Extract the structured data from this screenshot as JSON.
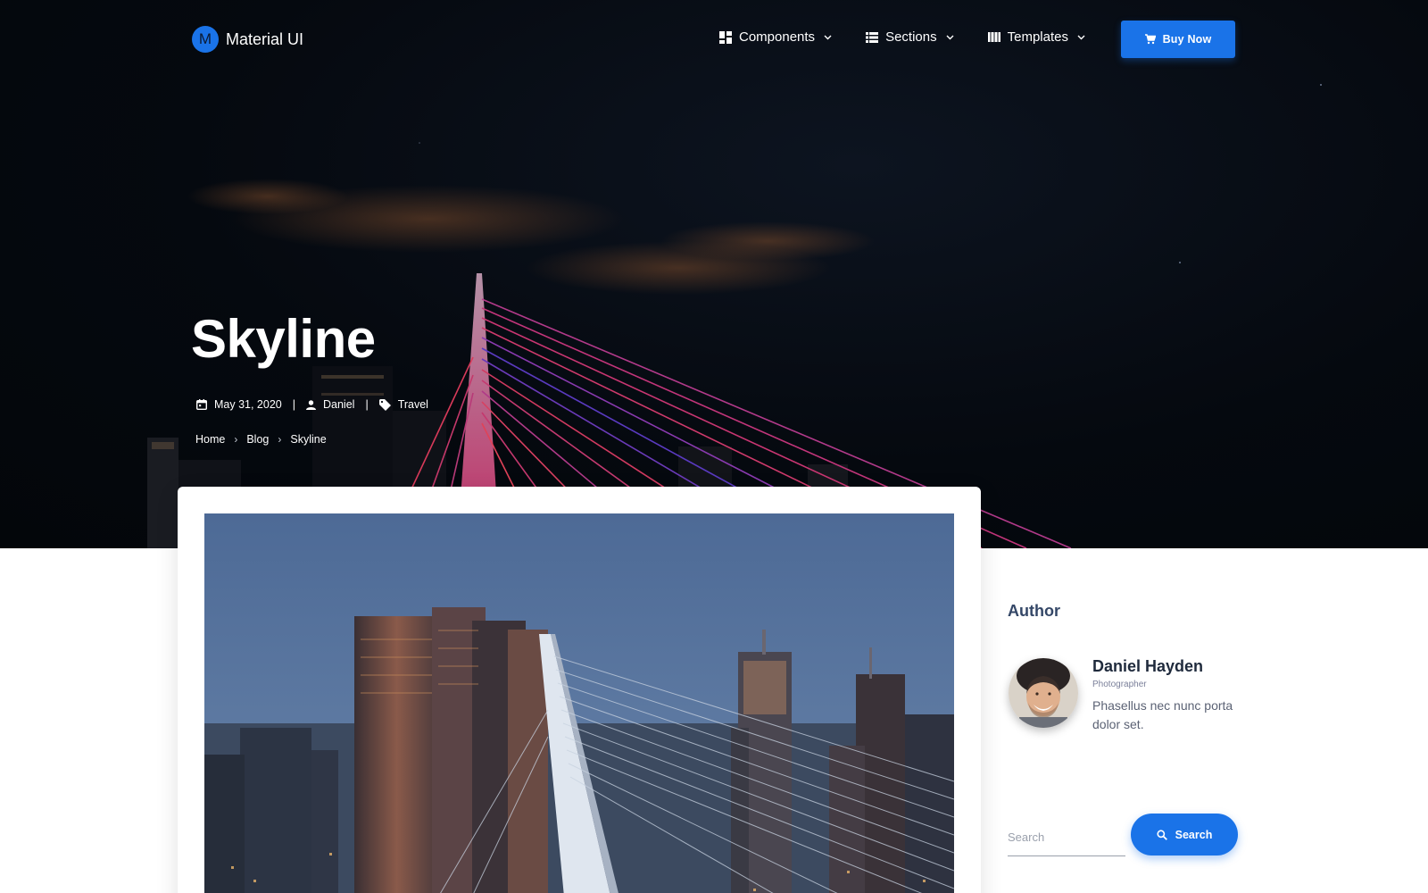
{
  "brand": {
    "logo_letter": "M",
    "name": "Material UI"
  },
  "nav": {
    "items": [
      {
        "label": "Components",
        "icon": "dashboard-icon"
      },
      {
        "label": "Sections",
        "icon": "view-list-icon"
      },
      {
        "label": "Templates",
        "icon": "view-column-icon"
      }
    ],
    "buy_button": "Buy Now"
  },
  "hero": {
    "title": "Skyline",
    "date": "May 31, 2020",
    "author": "Daniel",
    "category": "Travel",
    "meta_separator": "|"
  },
  "breadcrumb": {
    "items": [
      "Home",
      "Blog",
      "Skyline"
    ],
    "separator": "›"
  },
  "sidebar": {
    "author_heading": "Author",
    "author_name": "Daniel Hayden",
    "author_role": "Photographer",
    "author_bio": "Phasellus nec nunc porta dolor set.",
    "search_placeholder": "Search",
    "search_button": "Search"
  },
  "colors": {
    "primary": "#1a73e8",
    "hero_bg": "#05090f",
    "text": "#344767"
  }
}
